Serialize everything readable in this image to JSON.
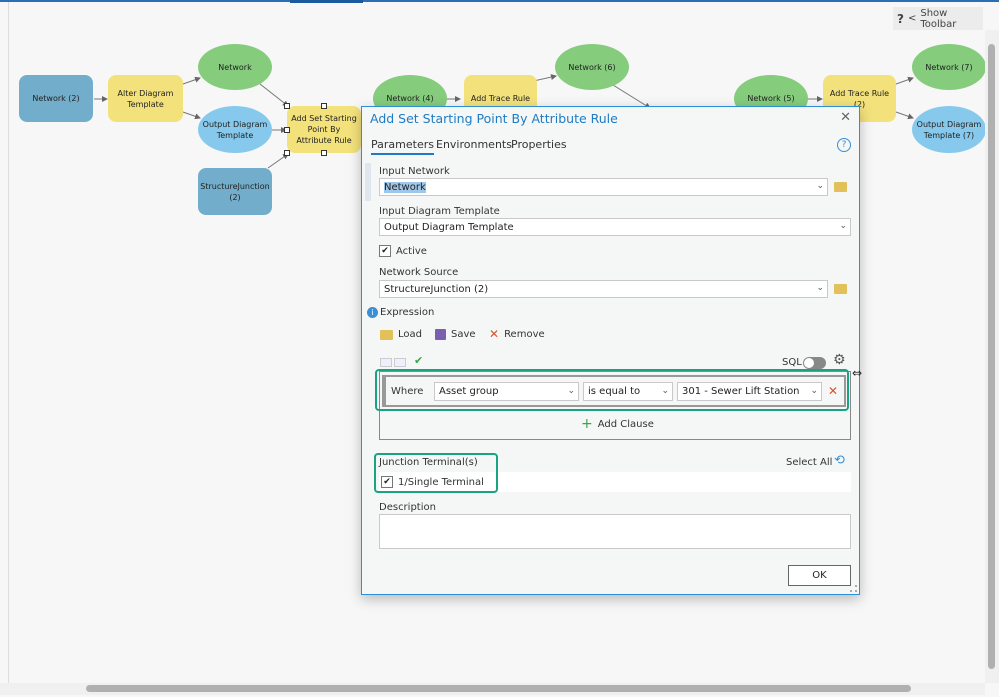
{
  "header": {
    "show_toolbar_label": "Show Toolbar",
    "help_glyph": "?",
    "chevron_glyph": "<"
  },
  "diagram": {
    "nodes": [
      {
        "label": "Network (2)",
        "kind": "data",
        "color": "#72aecb"
      },
      {
        "label": "Alter Diagram Template",
        "kind": "tool",
        "color": "#f3e27c"
      },
      {
        "label": "Network",
        "kind": "output",
        "color": "#85cc7d"
      },
      {
        "label": "Output Diagram Template",
        "kind": "output",
        "color": "#86c9ec"
      },
      {
        "label": "StructureJunction (2)",
        "kind": "data",
        "color": "#72aecb"
      },
      {
        "label": "Add Set Starting Point By Attribute Rule",
        "kind": "tool",
        "color": "#f3e27c",
        "selected": true
      },
      {
        "label": "Network (4)",
        "kind": "output",
        "color": "#85cc7d"
      },
      {
        "label": "Add Trace Rule",
        "kind": "tool",
        "color": "#f3e27c"
      },
      {
        "label": "Network (6)",
        "kind": "output",
        "color": "#85cc7d"
      },
      {
        "label": "Network (5)",
        "kind": "output",
        "color": "#85cc7d"
      },
      {
        "label": "Add Trace Rule (2)",
        "kind": "tool",
        "color": "#f3e27c"
      },
      {
        "label": "Network (7)",
        "kind": "output",
        "color": "#85cc7d"
      },
      {
        "label": "Output Diagram Template (7)",
        "kind": "output",
        "color": "#86c9ec"
      }
    ]
  },
  "dialog": {
    "title": "Add Set Starting Point By Attribute Rule",
    "close_glyph": "✕",
    "tabs": [
      {
        "label": "Parameters",
        "active": true
      },
      {
        "label": "Environments"
      },
      {
        "label": "Properties"
      }
    ],
    "help_glyph": "?",
    "input_network": {
      "label": "Input Network",
      "value": "Network"
    },
    "input_diagram_template": {
      "label": "Input Diagram Template",
      "value": "Output Diagram Template"
    },
    "active": {
      "label": "Active",
      "checked": true
    },
    "network_source": {
      "label": "Network Source",
      "value": "StructureJunction (2)"
    },
    "expression": {
      "label": "Expression",
      "load": "Load",
      "save": "Save",
      "remove": "Remove",
      "sql_label": "SQL",
      "sql_on": false,
      "clause": {
        "where": "Where",
        "field": "Asset group",
        "operator": "is equal to",
        "value": "301 - Sewer Lift Station"
      },
      "add_clause": "Add Clause"
    },
    "junction_terminals": {
      "label": "Junction Terminal(s)",
      "select_all": "Select All",
      "items": [
        {
          "label": "1/Single Terminal",
          "checked": true
        }
      ]
    },
    "description": {
      "label": "Description",
      "value": ""
    },
    "ok": "OK"
  },
  "colors": {
    "accent": "#1e7bc4",
    "highlight": "#19a383",
    "remove": "#d9532c"
  }
}
